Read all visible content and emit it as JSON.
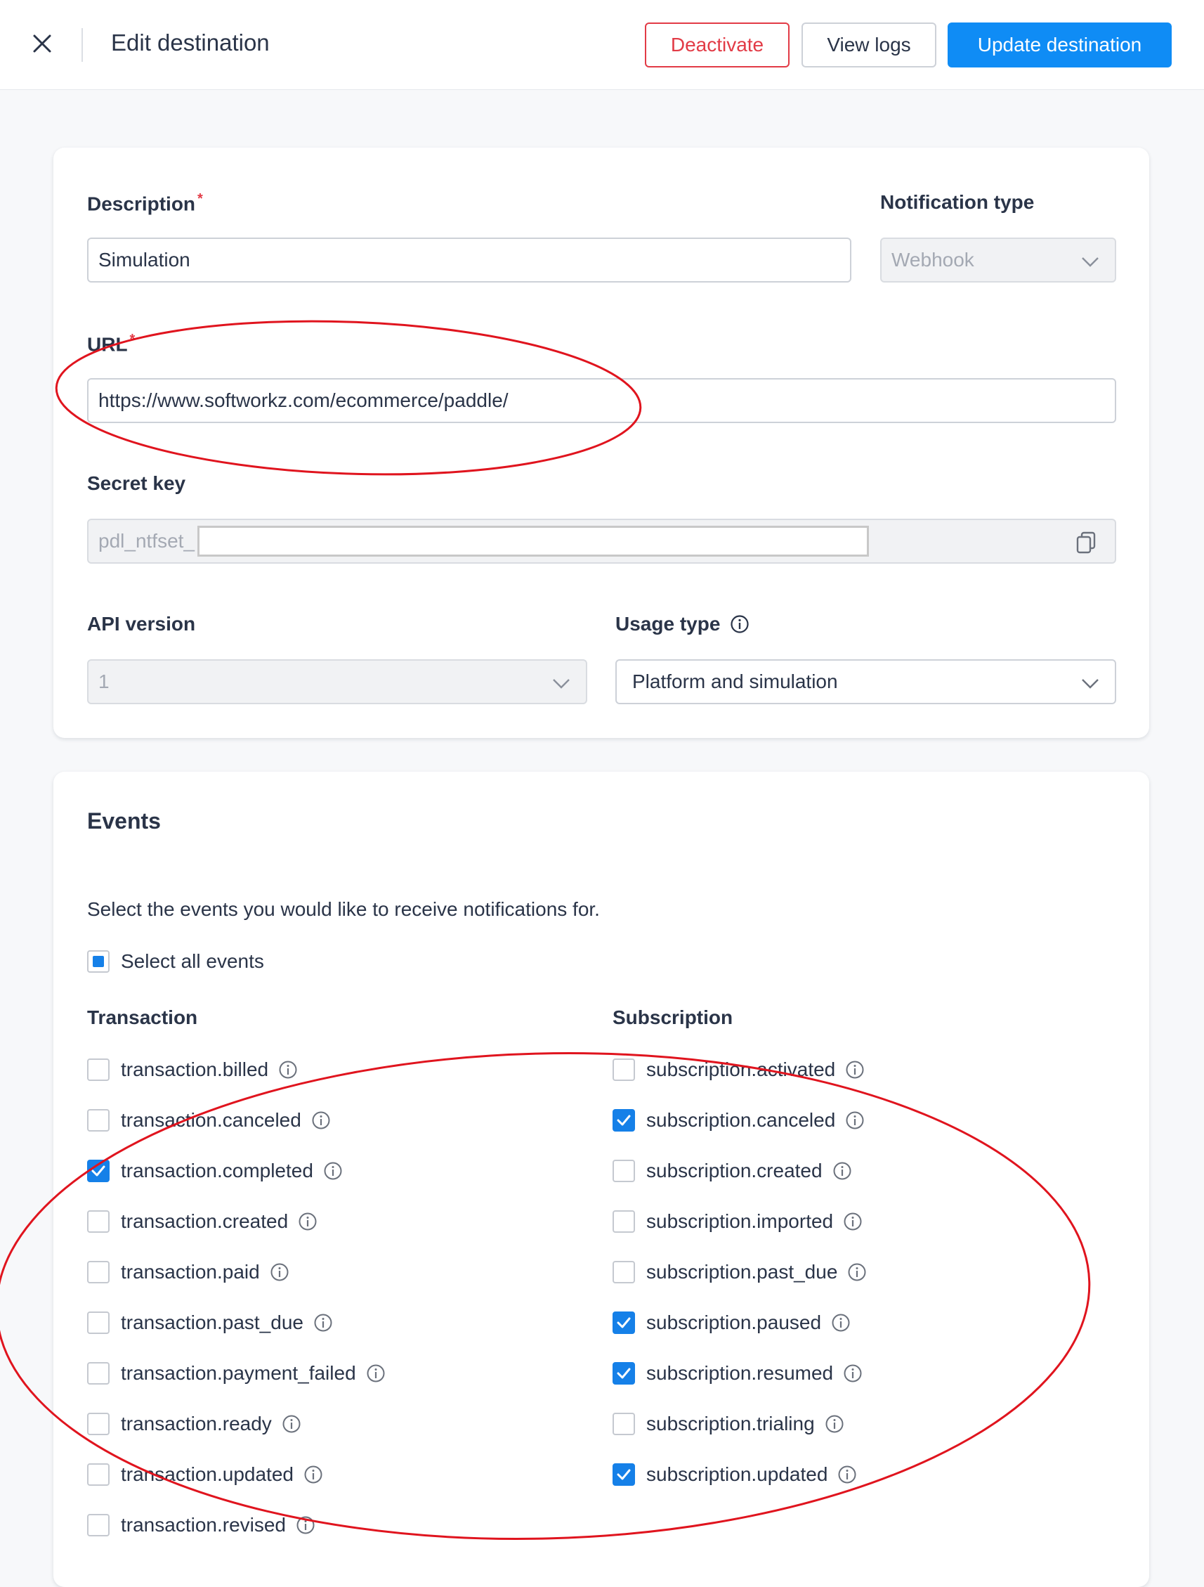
{
  "header": {
    "title": "Edit destination",
    "deactivate_label": "Deactivate",
    "view_logs_label": "View logs",
    "update_label": "Update destination"
  },
  "form": {
    "description_label": "Description",
    "description_value": "Simulation",
    "notification_type_label": "Notification type",
    "notification_type_value": "Webhook",
    "url_label": "URL",
    "url_value": "https://www.softworkz.com/ecommerce/paddle/",
    "secret_key_label": "Secret key",
    "secret_key_prefix": "pdl_ntfset_",
    "api_version_label": "API version",
    "api_version_value": "1",
    "usage_type_label": "Usage type",
    "usage_type_value": "Platform and simulation",
    "required_marker": "*"
  },
  "events": {
    "title": "Events",
    "description": "Select the events you would like to receive notifications for.",
    "select_all_label": "Select all events",
    "select_all_state": "indeterminate",
    "transaction_title": "Transaction",
    "subscription_title": "Subscription",
    "transaction": [
      {
        "label": "transaction.billed",
        "checked": false
      },
      {
        "label": "transaction.canceled",
        "checked": false
      },
      {
        "label": "transaction.completed",
        "checked": true
      },
      {
        "label": "transaction.created",
        "checked": false
      },
      {
        "label": "transaction.paid",
        "checked": false
      },
      {
        "label": "transaction.past_due",
        "checked": false
      },
      {
        "label": "transaction.payment_failed",
        "checked": false
      },
      {
        "label": "transaction.ready",
        "checked": false
      },
      {
        "label": "transaction.updated",
        "checked": false
      },
      {
        "label": "transaction.revised",
        "checked": false
      }
    ],
    "subscription": [
      {
        "label": "subscription.activated",
        "checked": false
      },
      {
        "label": "subscription.canceled",
        "checked": true
      },
      {
        "label": "subscription.created",
        "checked": false
      },
      {
        "label": "subscription.imported",
        "checked": false
      },
      {
        "label": "subscription.past_due",
        "checked": false
      },
      {
        "label": "subscription.paused",
        "checked": true
      },
      {
        "label": "subscription.resumed",
        "checked": true
      },
      {
        "label": "subscription.trialing",
        "checked": false
      },
      {
        "label": "subscription.updated",
        "checked": true
      }
    ]
  },
  "colors": {
    "primary": "#0f8cf5",
    "danger": "#e23b46",
    "checkbox": "#1580e8",
    "annotation": "#e0141e"
  }
}
